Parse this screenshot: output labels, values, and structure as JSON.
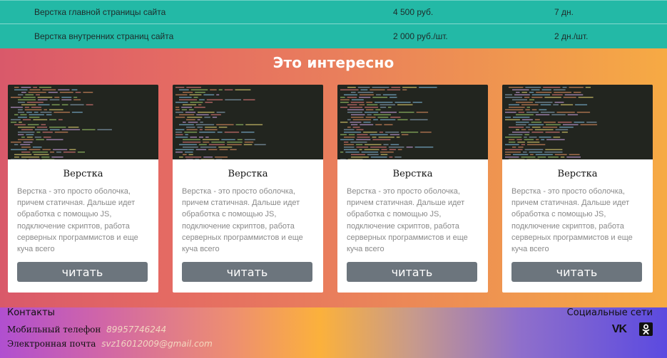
{
  "price_table": {
    "rows": [
      {
        "name": "Верстка главной страницы сайта",
        "price": "4 500 руб.",
        "term": "7 дн."
      },
      {
        "name": "Верстка внутренних страниц сайта",
        "price": "2 000 руб./шт.",
        "term": "2 дн./шт."
      }
    ]
  },
  "interesting": {
    "title": "Это интересно",
    "cards": [
      {
        "title": "Верстка",
        "text": "Верстка - это просто оболочка, причем статичная. Дальше идет обработка с помощью JS, подключение скриптов, работа серверных программистов и еще куча всего",
        "button": "читать"
      },
      {
        "title": "Верстка",
        "text": "Верстка - это просто оболочка, причем статичная. Дальше идет обработка с помощью JS, подключение скриптов, работа серверных программистов и еще куча всего",
        "button": "читать"
      },
      {
        "title": "Верстка",
        "text": "Верстка - это просто оболочка, причем статичная. Дальше идет обработка с помощью JS, подключение скриптов, работа серверных программистов и еще куча всего",
        "button": "читать"
      },
      {
        "title": "Верстка",
        "text": "Верстка - это просто оболочка, причем статичная. Дальше идет обработка с помощью JS, подключение скриптов, работа серверных программистов и еще куча всего",
        "button": "читать"
      }
    ]
  },
  "footer": {
    "contacts_title": "Контакты",
    "phone_label": "Мобильный телефон",
    "phone_value": "89957746244",
    "email_label": "Электронная почта",
    "email_value": "svz16012009@gmail.com",
    "social_title": "Социальные сети",
    "social_icons": [
      "vk-icon",
      "odnoklassniki-icon"
    ]
  },
  "colors": {
    "table_bg": "#23b9a6",
    "button_bg": "#6c757d",
    "gradient_start": "#d9596a",
    "gradient_end": "#f6aa44"
  }
}
